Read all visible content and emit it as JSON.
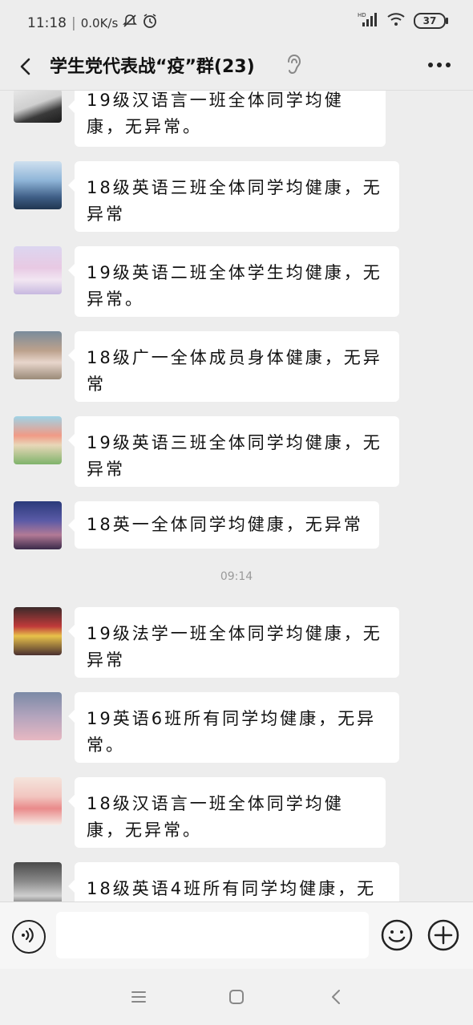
{
  "status_bar": {
    "time": "11:18",
    "separator": "|",
    "network_speed": "0.0K/s",
    "battery": "37",
    "signal_label": "HD"
  },
  "header": {
    "title": "学生党代表战“疫”群(23)"
  },
  "icons": {
    "back": "chevron-left-icon",
    "ear": "ear-icon",
    "more": "more-icon",
    "voice": "voice-icon",
    "emoji": "emoji-icon",
    "plus": "plus-icon"
  },
  "colors": {
    "background": "#ededed",
    "bubble": "#ffffff",
    "timestamp": "#9a9a9a"
  },
  "messages": [
    {
      "text": "19级汉语言一班全体同学均健康，无异常。"
    },
    {
      "text": "18级英语三班全体同学均健康，无异常"
    },
    {
      "text": "19级英语二班全体学生均健康，无异常。"
    },
    {
      "text": "18级广一全体成员身体健康，无异常"
    },
    {
      "text": "19级英语三班全体同学均健康，无异常"
    },
    {
      "text": "18英一全体同学均健康，无异常"
    },
    {
      "text": "19级法学一班全体同学均健康，无异常"
    },
    {
      "text": "19英语6班所有同学均健康，无异常。"
    },
    {
      "text": "18级汉语言一班全体同学均健康，无异常。"
    },
    {
      "text": "18级英语4班所有同学均健康，无"
    }
  ],
  "timestamp": "09:14",
  "input": {
    "value": "",
    "placeholder": ""
  }
}
